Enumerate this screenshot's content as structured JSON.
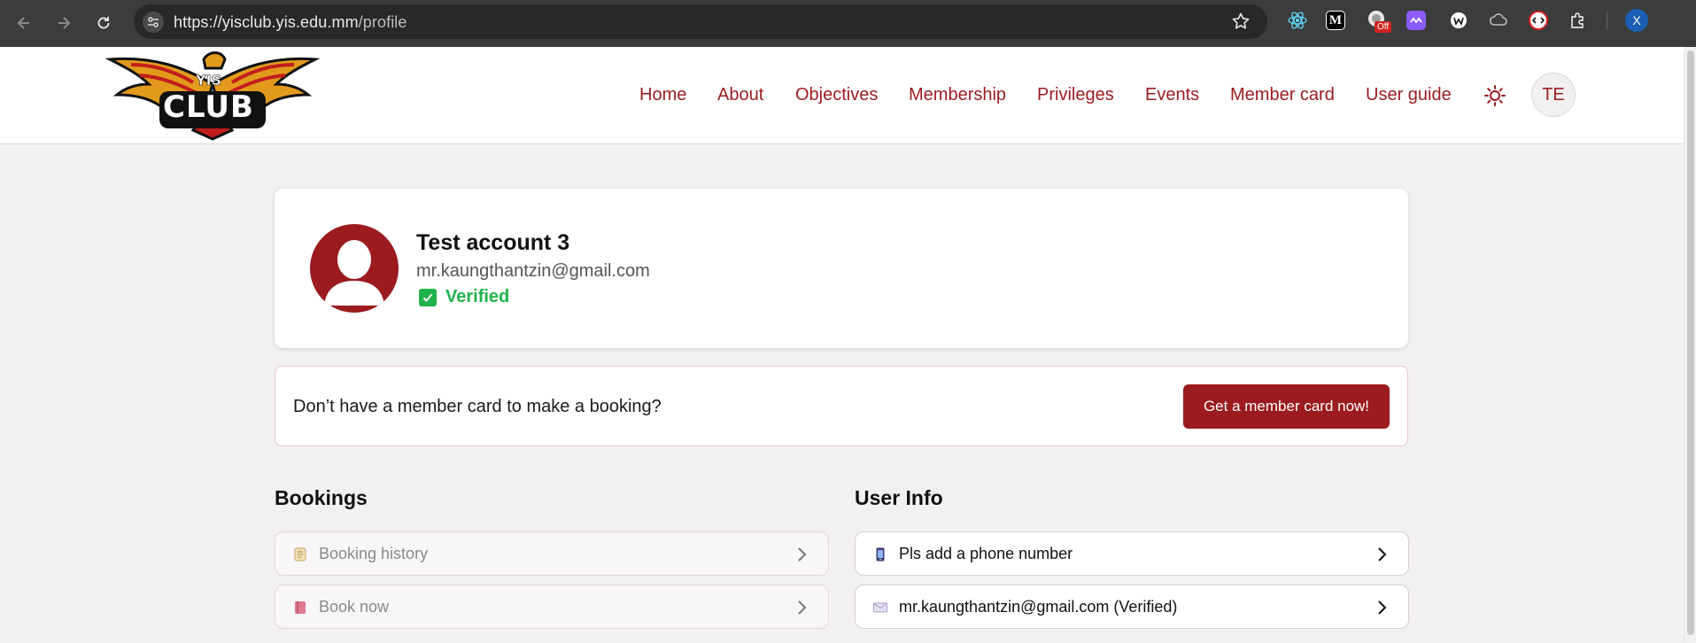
{
  "browser": {
    "url_host": "https://yisclub.yis.edu.mm",
    "url_path": "/profile",
    "profile_initial": "X",
    "extension_badge": "Off"
  },
  "header": {
    "logo_text_top": "YIS",
    "logo_text_bottom": "CLUB",
    "nav": [
      "Home",
      "About",
      "Objectives",
      "Membership",
      "Privileges",
      "Events",
      "Member card",
      "User guide"
    ],
    "user_initials": "TE"
  },
  "profile": {
    "name": "Test account 3",
    "email": "mr.kaungthantzin@gmail.com",
    "verified_label": "Verified"
  },
  "banner": {
    "text": "Don’t have a member card to make a booking?",
    "button": "Get a member card now!"
  },
  "bookings": {
    "title": "Bookings",
    "items": [
      {
        "label": "Booking history",
        "icon": "scroll-icon"
      },
      {
        "label": "Book now",
        "icon": "book-icon"
      }
    ]
  },
  "user_info": {
    "title": "User Info",
    "items": [
      {
        "label": "Pls add a phone number",
        "icon": "phone-icon"
      },
      {
        "label": "mr.kaungthantzin@gmail.com (Verified)",
        "icon": "envelope-icon"
      }
    ]
  },
  "colors": {
    "brand": "#9b1b1f",
    "verified": "#1fb24a",
    "page_bg": "#f3f0f1"
  }
}
